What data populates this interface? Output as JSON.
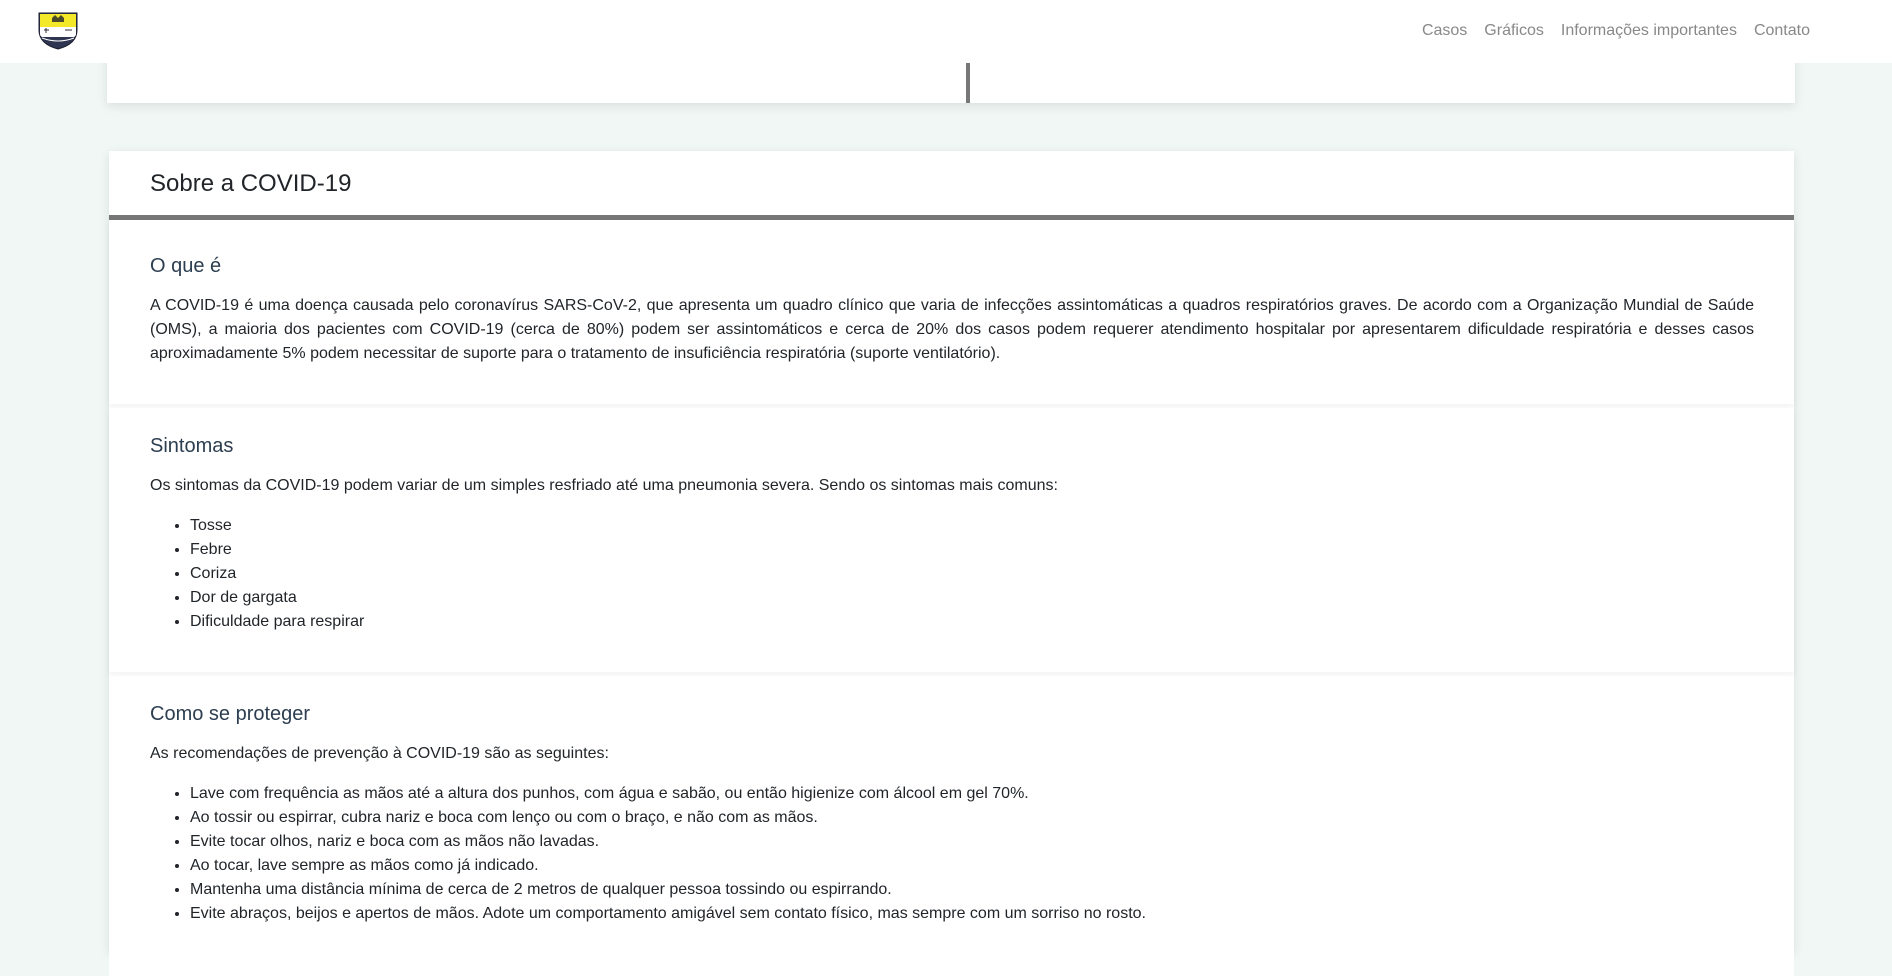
{
  "nav": {
    "links": [
      "Casos",
      "Gráficos",
      "Informações importantes",
      "Contato"
    ]
  },
  "about": {
    "title": "Sobre a COVID-19",
    "sections": {
      "what": {
        "title": "O que é",
        "text": "A COVID-19 é uma doença causada pelo coronavírus SARS-CoV-2, que apresenta um quadro clínico que varia de infecções assintomáticas a quadros respiratórios graves. De acordo com a Organização Mundial de Saúde (OMS), a maioria dos pacientes com COVID-19 (cerca de 80%) podem ser assintomáticos e cerca de 20% dos casos podem requerer atendimento hospitalar por apresentarem dificuldade respiratória e desses casos aproximadamente 5% podem necessitar de suporte para o tratamento de insuficiência respiratória (suporte ventilatório)."
      },
      "symptoms": {
        "title": "Sintomas",
        "intro": "Os sintomas da COVID-19 podem variar de um simples resfriado até uma pneumonia severa. Sendo os sintomas mais comuns:",
        "items": [
          "Tosse",
          "Febre",
          "Coriza",
          "Dor de gargata",
          "Dificuldade para respirar"
        ]
      },
      "protect": {
        "title": "Como se proteger",
        "intro": "As recomendações de prevenção à COVID-19 são as seguintes:",
        "items": [
          "Lave com frequência as mãos até a altura dos punhos, com água e sabão, ou então higienize com álcool em gel 70%.",
          "Ao tossir ou espirrar, cubra nariz e boca com lenço ou com o braço, e não com as mãos.",
          "Evite tocar olhos, nariz e boca com as mãos não lavadas.",
          "Ao tocar, lave sempre as mãos como já indicado.",
          "Mantenha uma distância mínima de cerca de 2 metros de qualquer pessoa tossindo ou espirrando.",
          "Evite abraços, beijos e apertos de mãos. Adote um comportamento amigável sem contato físico, mas sempre com um sorriso no rosto."
        ]
      }
    }
  },
  "colors": {
    "background": "#f1f7f5",
    "card": "#ffffff",
    "accent_border": "#777777",
    "nav_link": "#888888",
    "heading": "#2c3e50"
  }
}
